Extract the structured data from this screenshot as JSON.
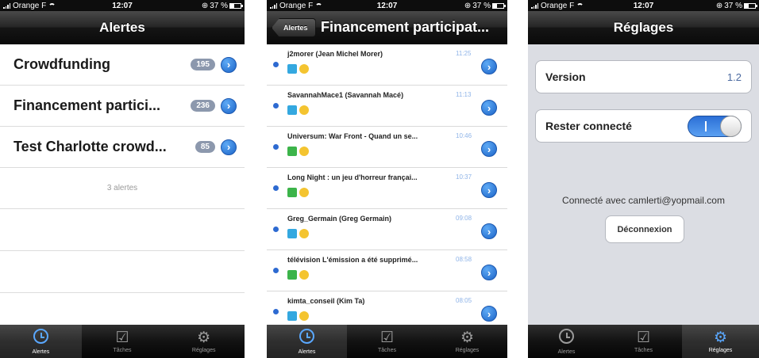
{
  "status_bars": [
    {
      "carrier": "Orange F",
      "time": "12:07",
      "battery": "37 %"
    },
    {
      "carrier": "Orange F",
      "time": "12:07",
      "battery": "37 %"
    },
    {
      "carrier": "Orange F",
      "time": "12:07",
      "battery": "37 %"
    }
  ],
  "tabs": [
    {
      "label": "Alertes",
      "icon": "clock-icon"
    },
    {
      "label": "Tâches",
      "icon": "checkbox-icon"
    },
    {
      "label": "Réglages",
      "icon": "gear-icon"
    }
  ],
  "screen1": {
    "title": "Alertes",
    "active_tab": "Alertes",
    "alerts": [
      {
        "title": "Crowdfunding",
        "count": "195"
      },
      {
        "title": "Financement partici...",
        "count": "236"
      },
      {
        "title": "Test Charlotte crowd...",
        "count": "85"
      }
    ],
    "summary": "3 alertes"
  },
  "screen2": {
    "back_label": "Alertes",
    "title": "Financement participat...",
    "active_tab": "Alertes",
    "items": [
      {
        "author": "j2morer (Jean Michel Morer)",
        "time": "11:25",
        "source": "twitter"
      },
      {
        "author": "SavannahMace1 (Savannah Macé)",
        "time": "11:13",
        "source": "twitter"
      },
      {
        "author": "Universum: War Front - Quand un se...",
        "time": "10:46",
        "source": "web"
      },
      {
        "author": "Long Night : un jeu d'horreur françai...",
        "time": "10:37",
        "source": "web"
      },
      {
        "author": "Greg_Germain (Greg Germain)",
        "time": "09:08",
        "source": "twitter"
      },
      {
        "author": "télévision L'émission a été supprimé...",
        "time": "08:58",
        "source": "web"
      },
      {
        "author": "kimta_conseil (Kim Ta)",
        "time": "08:05",
        "source": "twitter"
      }
    ]
  },
  "screen3": {
    "title": "Réglages",
    "active_tab": "Réglages",
    "version_label": "Version",
    "version_value": "1.2",
    "stay_connected_label": "Rester connecté",
    "stay_connected_value": true,
    "connected_text": "Connecté avec camlerti@yopmail.com",
    "logout_label": "Déconnexion"
  },
  "colors": {
    "accent_blue": "#2d6ad1",
    "badge_gray": "#8c98ad",
    "settings_bg": "#dbdde3"
  }
}
